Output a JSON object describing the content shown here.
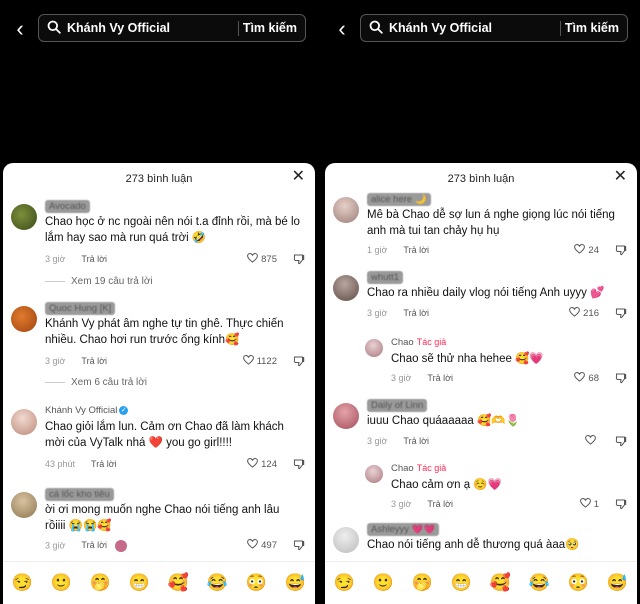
{
  "search_query": "Khánh Vy Official",
  "search_button": "Tìm kiếm",
  "comment_count_label": "273 bình luận",
  "reply_label": "Trả lời",
  "emoji_bar": [
    "😏",
    "🙂",
    "🤭",
    "😁",
    "🥰",
    "😂",
    "😳",
    "😅"
  ],
  "left": {
    "comments": [
      {
        "name": "Avocado",
        "text": "Chao học ở nc ngoài nên nói t.a đỉnh rồi, mà bé lo lắm hay sao mà run quá trời 🤣",
        "time": "3 giờ",
        "likes": "875",
        "view_replies": "Xem 19 câu trả lời"
      },
      {
        "name": "Quoc Hung [K]",
        "text": "Khánh Vy phát âm nghe tự tin ghê. Thực chiến nhiều. Chao hơi run trước ống kính🥰",
        "time": "3 giờ",
        "likes": "1122",
        "view_replies": "Xem 6 câu trả lời"
      },
      {
        "name": "Khánh Vy Official",
        "text": "Chao giỏi lắm lun. Cảm ơn Chao đã làm khách mời của VyTalk nhá ❤️ you go girl!!!!",
        "time": "43 phút",
        "likes": "124"
      },
      {
        "name": "cá lốc kho tiêu",
        "text": "ời ơi mong muốn nghe Chao nói tiếng anh lâu rồiiii 😭😭🥰",
        "time": "3 giờ",
        "likes": "497"
      }
    ]
  },
  "right": {
    "comments": [
      {
        "name": "alice here 🌙",
        "text": "Mê bà Chao dễ sợ lun á nghe giọng lúc nói tiếng anh mà tui tan chảy hụ hụ",
        "time": "1 giờ",
        "likes": "24"
      },
      {
        "name": "whutt1",
        "text": "Chao ra nhiều daily vlog nói tiếng Anh uyyy 💕",
        "time": "3 giờ",
        "likes": "216"
      },
      {
        "name": "Chao",
        "tag": "Tác giả",
        "text": "Chao sẽ thử nha hehee 🥰💗",
        "time": "3 giờ",
        "likes": "68"
      },
      {
        "name": "Daily of Linn",
        "text": "iuuu Chao quáaaaaa 🥰🫶🌷",
        "time": "3 giờ",
        "likes": ""
      },
      {
        "name": "Chao",
        "tag": "Tác giả",
        "text": "Chao cảm ơn ạ ☺️💗",
        "time": "3 giờ",
        "likes": "1"
      },
      {
        "name": "Ashleyyy 💗💗",
        "text": "Chao nói tiếng anh dễ thương quá àaa🥺",
        "time": "",
        "likes": ""
      }
    ]
  }
}
